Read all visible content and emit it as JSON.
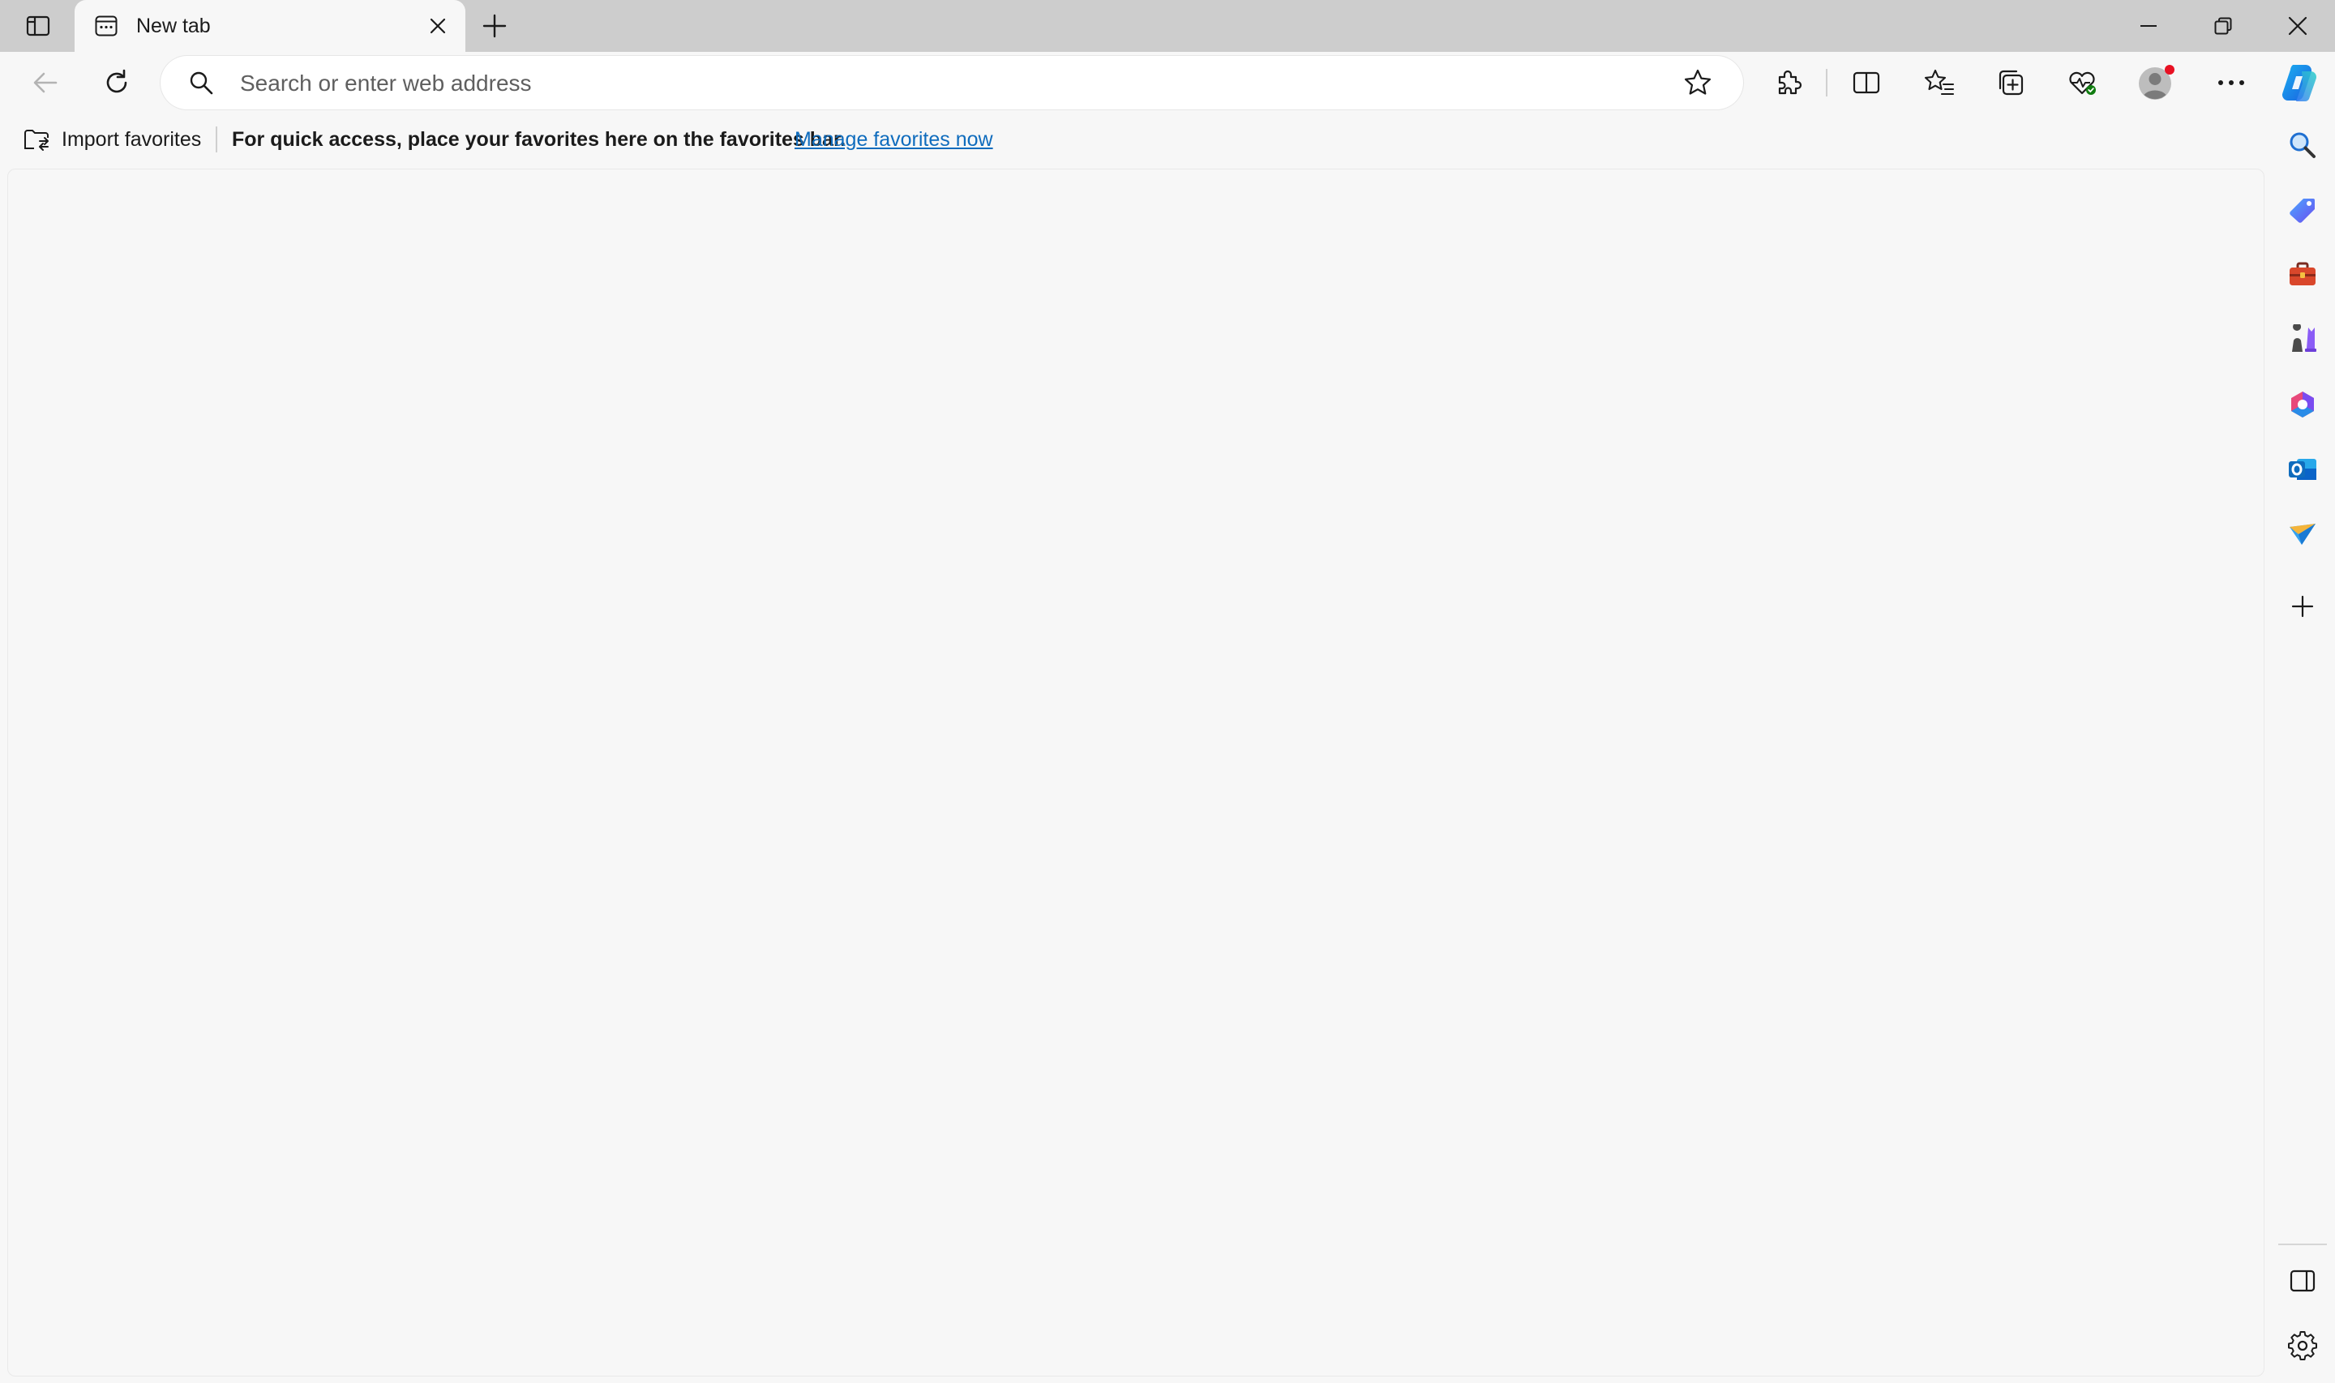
{
  "tab": {
    "title": "New tab"
  },
  "address_bar": {
    "placeholder": "Search or enter web address",
    "value": ""
  },
  "favorites_bar": {
    "import_label": "Import favorites",
    "hint": "For quick access, place your favorites here on the favorites bar.",
    "manage_link": "Manage favorites now"
  },
  "icons": {
    "title_bar": [
      "tab-actions-icon",
      "tab-favicon-icon",
      "close-icon",
      "plus-icon",
      "minimize-icon",
      "restore-icon",
      "close-icon"
    ],
    "toolbar": [
      "back-arrow-icon",
      "refresh-icon",
      "search-icon",
      "star-icon",
      "extensions-puzzle-icon",
      "split-screen-icon",
      "favorites-icon",
      "collections-icon",
      "browser-essentials-icon",
      "profile-avatar-icon",
      "more-dots-icon",
      "copilot-icon"
    ],
    "sidebar": [
      "search-icon",
      "shopping-tag-icon",
      "tools-briefcase-icon",
      "games-chess-icon",
      "microsoft-365-icon",
      "outlook-icon",
      "send-plane-icon",
      "plus-icon",
      "sidebar-layout-icon",
      "settings-gear-icon"
    ]
  },
  "colors": {
    "title_bar": "#cdcdcd",
    "surface": "#f7f7f7",
    "link": "#0f6cbd",
    "profile_badge": "#e81123",
    "essentials_badge": "#107c10"
  }
}
